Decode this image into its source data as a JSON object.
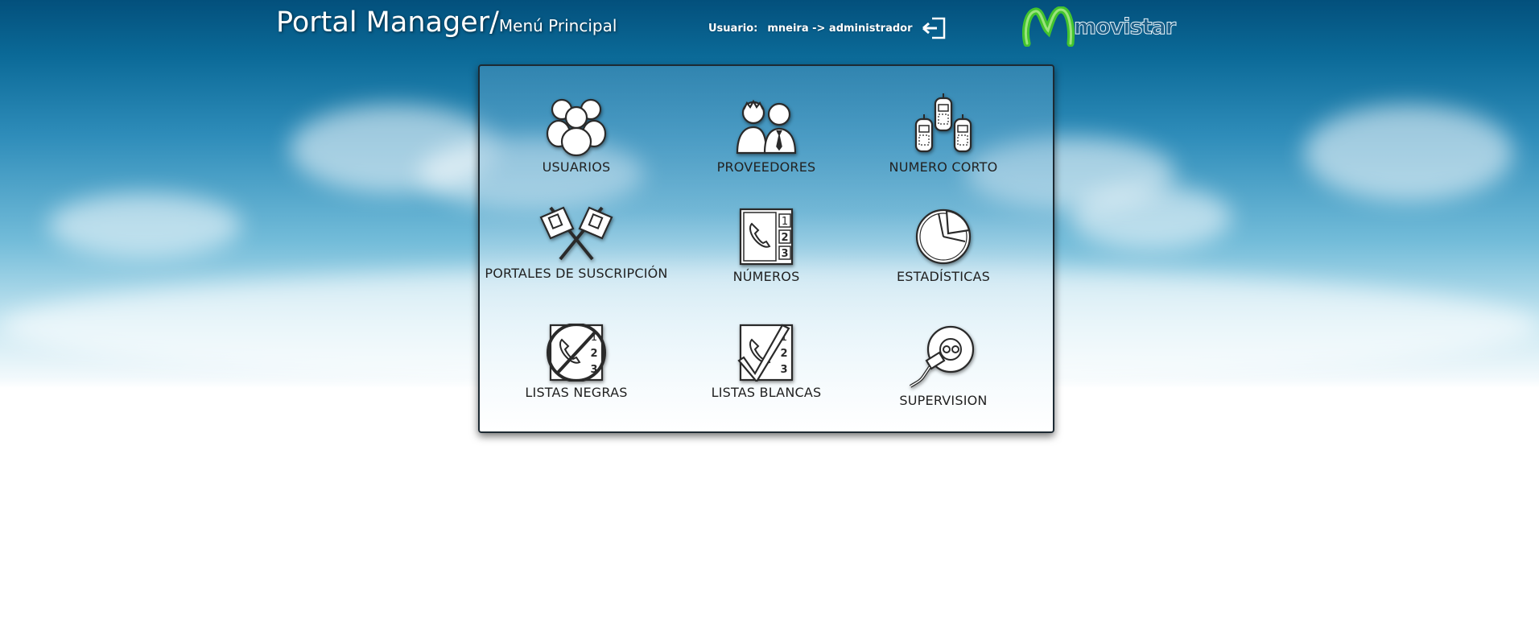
{
  "header": {
    "app_title": "Portal Manager/",
    "page_title": "Menú Principal",
    "user_label": "Usuario:",
    "user_value": "mneira -> administrador",
    "logout_icon": "logout-icon",
    "brand": "movistar",
    "brand_color": "#3bbf2c"
  },
  "menu": {
    "items": [
      {
        "label": "USUARIOS",
        "icon": "users-icon"
      },
      {
        "label": "PROVEEDORES",
        "icon": "providers-icon"
      },
      {
        "label": "NUMERO CORTO",
        "icon": "mobile-phones-icon"
      },
      {
        "label": "PORTALES DE SUSCRIPCIÓN",
        "icon": "flags-icon"
      },
      {
        "label": "NÚMEROS",
        "icon": "phone-numbers-icon"
      },
      {
        "label": "ESTADÍSTICAS",
        "icon": "pie-chart-icon"
      },
      {
        "label": "LISTAS NEGRAS",
        "icon": "blocked-phone-icon"
      },
      {
        "label": "LISTAS BLANCAS",
        "icon": "checked-phone-icon"
      },
      {
        "label": "SUPERVISION",
        "icon": "plug-icon"
      }
    ]
  }
}
